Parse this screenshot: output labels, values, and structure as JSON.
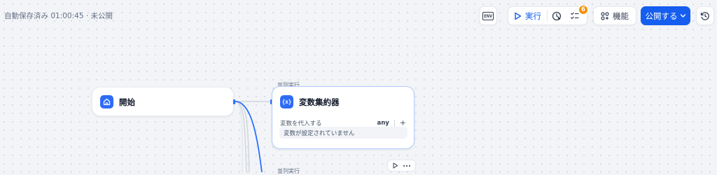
{
  "status": {
    "text": "自動保存済み 01:00:45 · 未公開"
  },
  "toolbar": {
    "env_label": "ENV",
    "run_label": "実行",
    "checklist_count": "6",
    "features_label": "機能",
    "publish_label": "公開する"
  },
  "canvas": {
    "start_node": {
      "title": "開始"
    },
    "parallel_label": "並列実行",
    "parallel_label_2": "並列実行",
    "aggregator_node": {
      "title": "変数集約器",
      "assign_label": "変数を代入する",
      "var_type": "any",
      "empty_text": "変数が設定されていません",
      "icon_text": "{x}"
    }
  },
  "colors": {
    "accent": "#155eef",
    "badge": "#f79009",
    "node_icon": "#2e6cf6",
    "edge": "#2970ff"
  }
}
